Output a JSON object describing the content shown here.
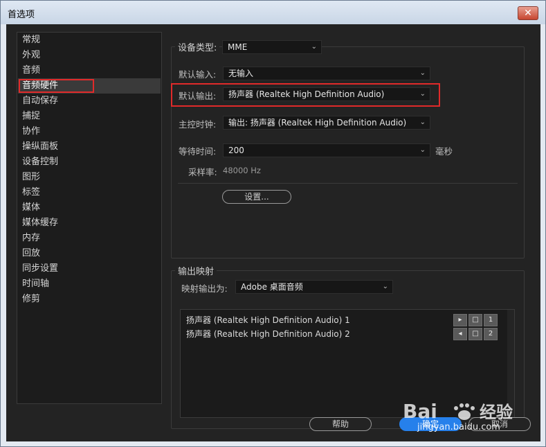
{
  "window": {
    "title": "首选项",
    "close_glyph": "✕"
  },
  "sidebar": {
    "items": [
      "常规",
      "外观",
      "音频",
      "音频硬件",
      "自动保存",
      "捕捉",
      "协作",
      "操纵面板",
      "设备控制",
      "图形",
      "标签",
      "媒体",
      "媒体缓存",
      "内存",
      "回放",
      "同步设置",
      "时间轴",
      "修剪"
    ],
    "selected": "音频硬件"
  },
  "device": {
    "type_label": "设备类型:",
    "type_value": "MME",
    "input_label": "默认输入:",
    "input_value": "无输入",
    "output_label": "默认输出:",
    "output_value": "扬声器 (Realtek High Definition Audio)",
    "clock_label": "主控时钟:",
    "clock_value": "输出: 扬声器 (Realtek High Definition Audio)",
    "latency_label": "等待时间:",
    "latency_value": "200",
    "latency_unit": "毫秒",
    "sample_rate_label": "采样率:",
    "sample_rate_value": "48000 Hz",
    "settings_button": "设置..."
  },
  "mapping": {
    "group_title": "输出映射",
    "map_label": "映射输出为:",
    "map_value": "Adobe 桌面音频",
    "rows": [
      {
        "label": "扬声器 (Realtek High Definition Audio) 1",
        "channel": "1"
      },
      {
        "label": "扬声器 (Realtek High Definition Audio) 2",
        "channel": "2"
      }
    ]
  },
  "footer": {
    "help": "帮助",
    "ok": "确定",
    "cancel": "取消"
  },
  "watermark": {
    "text": "jingyan.baidu.com"
  },
  "colors": {
    "highlight_box": "#e12a2a",
    "primary_button": "#2680eb",
    "background": "#232323"
  },
  "icons": {
    "chevron": "chevron-down-icon",
    "speaker_left": "speaker-icon",
    "speaker_right": "speaker-icon",
    "channel_box": "channel-square-icon"
  }
}
